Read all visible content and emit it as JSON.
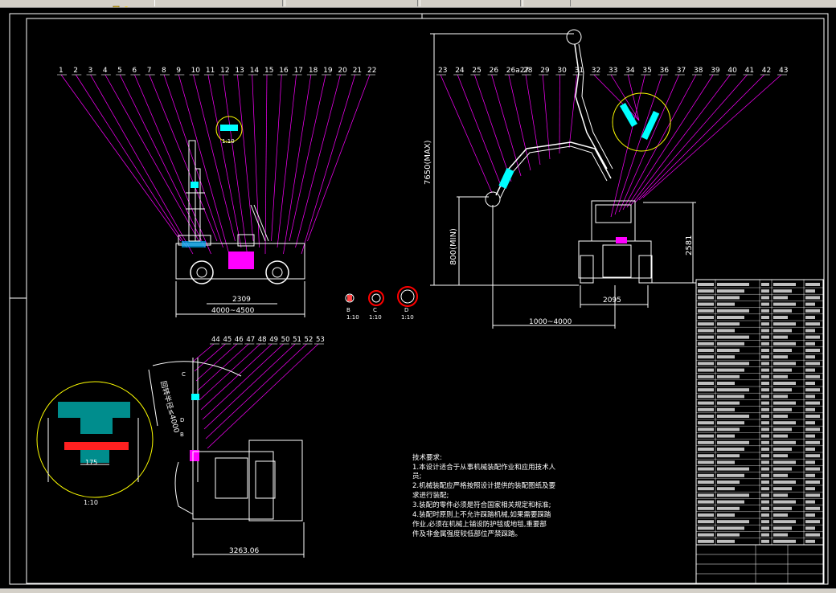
{
  "toolbar": {
    "fields": [
      "",
      "",
      "",
      "",
      ""
    ],
    "tools": [
      "layer-icon",
      "sun-icon",
      "lock-icon"
    ]
  },
  "drawing": {
    "side_view": {
      "callouts": [
        "1",
        "2",
        "3",
        "4",
        "5",
        "6",
        "7",
        "8",
        "9",
        "10",
        "11",
        "12",
        "13",
        "14",
        "15",
        "16",
        "17",
        "18",
        "19",
        "20",
        "21",
        "22"
      ],
      "detail_scale": "1:10",
      "dim_wheelbase": "2309",
      "dim_length": "4000~4500"
    },
    "front_view": {
      "callouts": [
        "23",
        "24",
        "25",
        "26",
        "26a27",
        "28",
        "29",
        "30",
        "31",
        "32",
        "33",
        "34",
        "35",
        "36",
        "37",
        "38",
        "39",
        "40",
        "41",
        "42",
        "43"
      ],
      "dim_height_max": "7650(MAX)",
      "dim_height_min": "800(MIN)",
      "dim_height_cab": "2581",
      "dim_track": "2095",
      "dim_reach": "1000~4000"
    },
    "section_labels": [
      {
        "letter": "B",
        "scale": "1:10"
      },
      {
        "letter": "C",
        "scale": "1:10"
      },
      {
        "letter": "D",
        "scale": "1:10"
      }
    ],
    "plan_view": {
      "callouts": [
        "44",
        "45",
        "46",
        "47",
        "48",
        "49",
        "50",
        "51",
        "52",
        "53"
      ],
      "dim_radius": "回转半径≤4000",
      "dim_width": "3263.06",
      "letters": [
        "C",
        "D",
        "B"
      ]
    },
    "detail_view": {
      "dim": "175",
      "scale": "1:10"
    },
    "tech_requirements": {
      "title": "技术要求:",
      "lines": [
        "1.本设计适合于从事机械装配作业和应用技术人",
        "员;",
        "2.机械装配应严格按照设计提供的装配图纸及要",
        "求进行装配;",
        "3.装配的零件必须是符合国家相关规定和标准;",
        "4.装配时原则上不允许踩踏机械,如果需要踩踏",
        "作业,必须在机械上铺设防护毯或地毯,重要部",
        "件及非金属强度较低部位严禁踩踏。"
      ]
    }
  },
  "statusbar": {
    "text": ""
  },
  "colors": {
    "background": "#000000",
    "line_white": "#ffffff",
    "leader_magenta": "#ff00ff",
    "cyan": "#00ffff",
    "yellow": "#ffff00",
    "red": "#ff0000"
  }
}
